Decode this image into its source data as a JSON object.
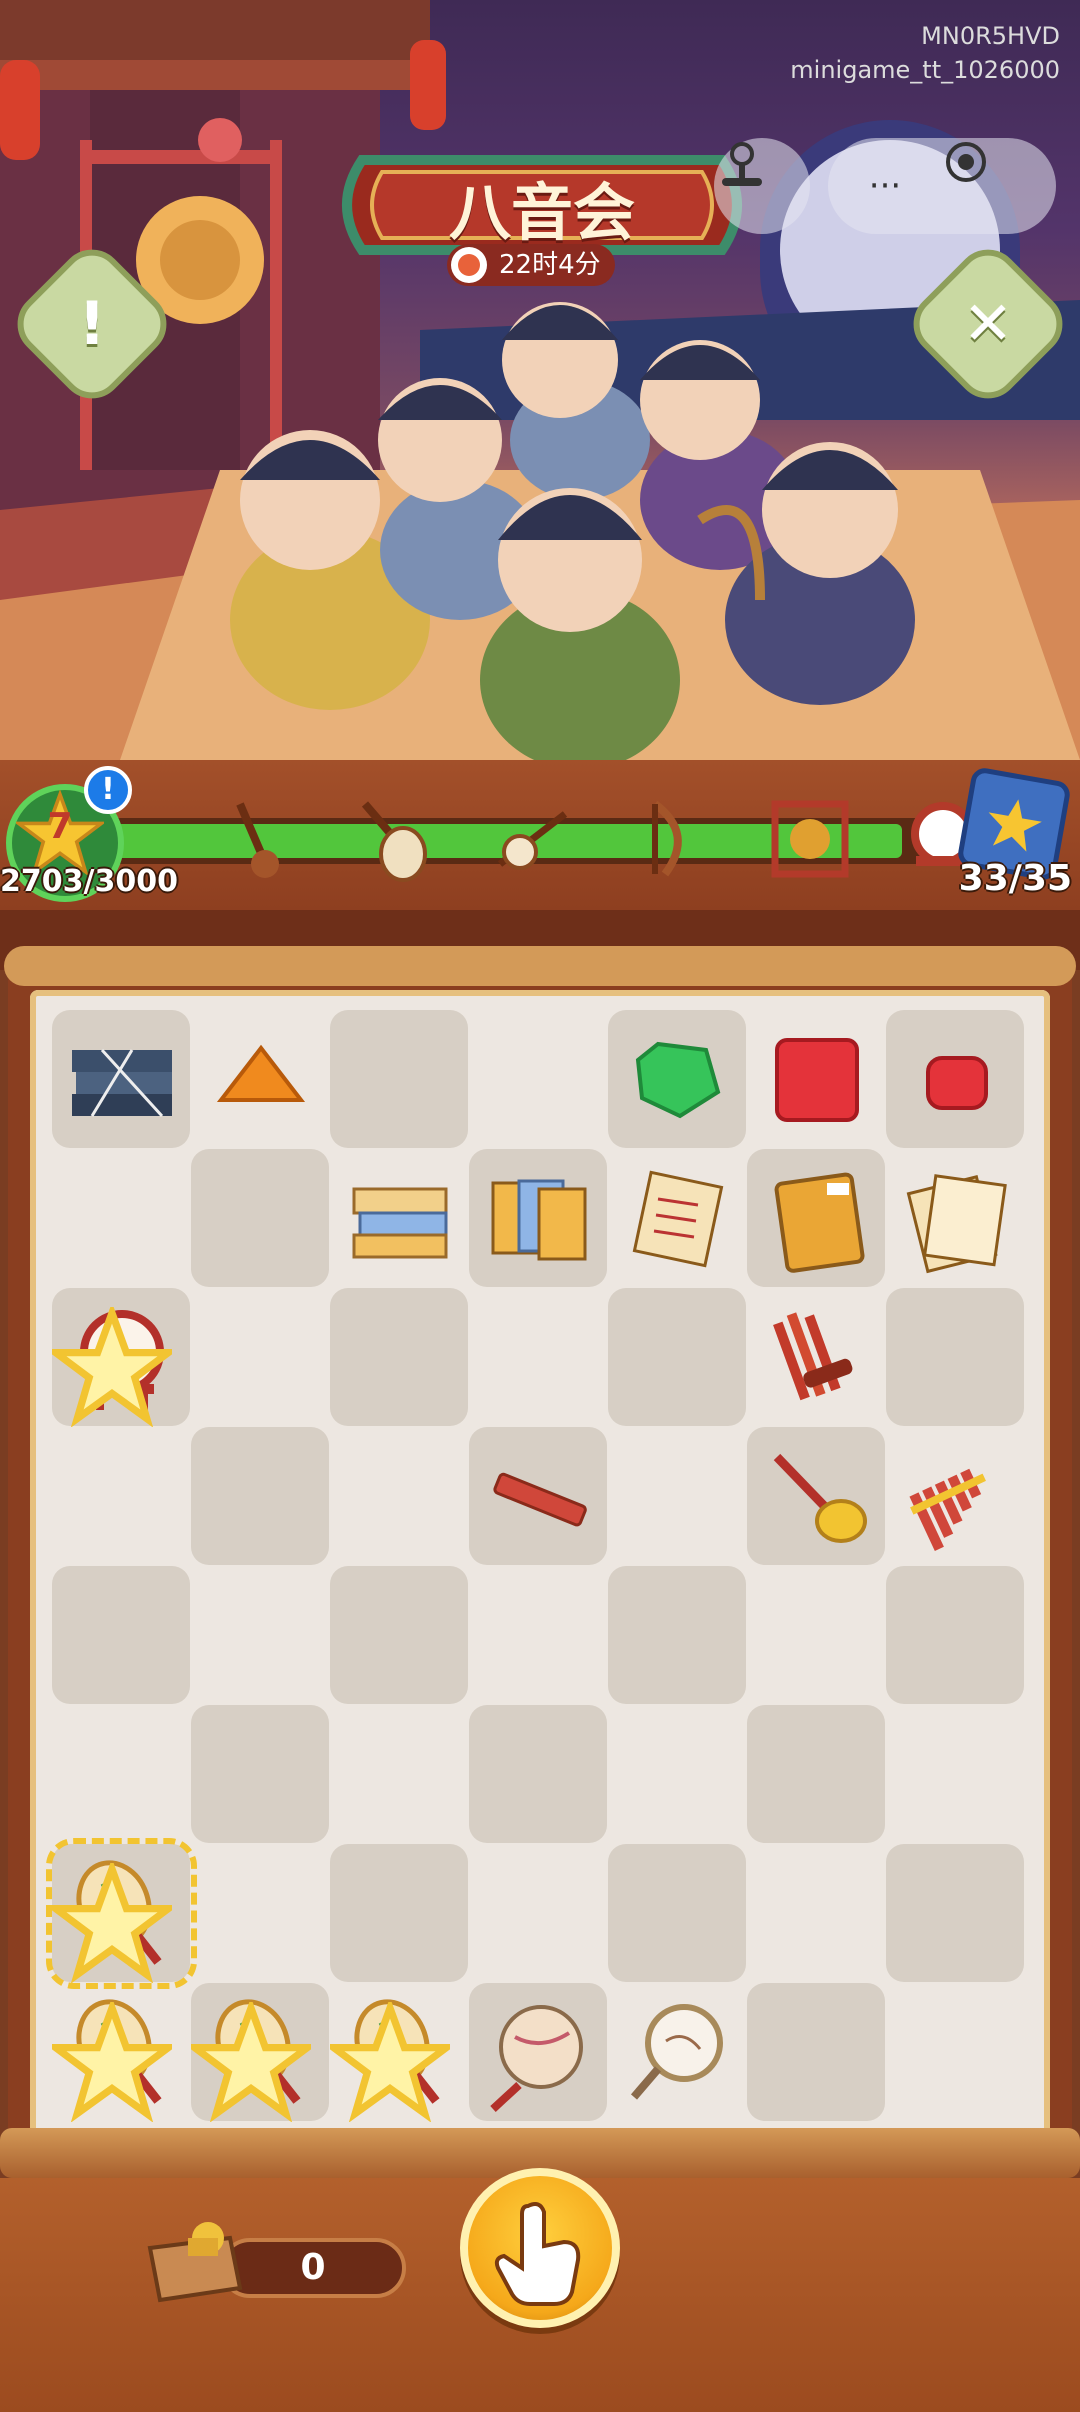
{
  "watermark": {
    "code": "MN0R5HVD",
    "app_id": "minigame_tt_1026000"
  },
  "event": {
    "title": "八音会",
    "timer": "22时4分"
  },
  "top_bar": {
    "info_icon": "exclamation-icon",
    "close_icon": "close-icon",
    "capsule_more": "···"
  },
  "progress": {
    "level": "7",
    "xp_text": "2703/3000",
    "xp_fraction": 0.9,
    "collection_text": "33/35",
    "milestones": [
      "erhu-icon",
      "pipa-icon",
      "sanxian-icon",
      "harp-icon",
      "gong-icon",
      "drum-icon"
    ]
  },
  "board": {
    "items": [
      {
        "r": 0,
        "c": 0,
        "type": "dusty-books"
      },
      {
        "r": 0,
        "c": 1,
        "type": "amber-gem"
      },
      {
        "r": 0,
        "c": 4,
        "type": "green-gem"
      },
      {
        "r": 0,
        "c": 5,
        "type": "red-gem-large"
      },
      {
        "r": 0,
        "c": 6,
        "type": "red-gem-small"
      },
      {
        "r": 1,
        "c": 2,
        "type": "book-stack"
      },
      {
        "r": 1,
        "c": 3,
        "type": "music-booklets"
      },
      {
        "r": 1,
        "c": 4,
        "type": "sheet-music-scroll"
      },
      {
        "r": 1,
        "c": 5,
        "type": "yellow-book"
      },
      {
        "r": 1,
        "c": 6,
        "type": "sheet-music-pages"
      },
      {
        "r": 2,
        "c": 0,
        "type": "drum",
        "star": true
      },
      {
        "r": 2,
        "c": 5,
        "type": "sheng-pipes"
      },
      {
        "r": 3,
        "c": 3,
        "type": "bamboo-slip"
      },
      {
        "r": 3,
        "c": 5,
        "type": "suona-horn"
      },
      {
        "r": 3,
        "c": 6,
        "type": "pan-flute"
      },
      {
        "r": 6,
        "c": 0,
        "type": "fan",
        "star": true,
        "selected": true
      },
      {
        "r": 7,
        "c": 0,
        "type": "fan",
        "star": true
      },
      {
        "r": 7,
        "c": 1,
        "type": "fan",
        "star": true
      },
      {
        "r": 7,
        "c": 2,
        "type": "fan",
        "star": true
      },
      {
        "r": 7,
        "c": 3,
        "type": "painted-fan"
      },
      {
        "r": 7,
        "c": 4,
        "type": "round-mirror"
      }
    ]
  },
  "footer": {
    "chest_count": "0"
  }
}
